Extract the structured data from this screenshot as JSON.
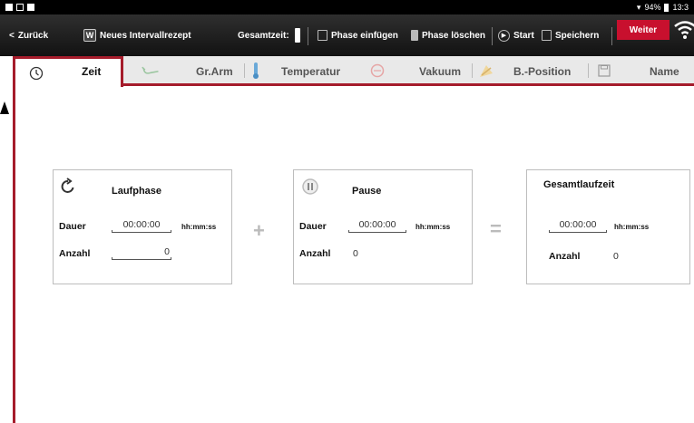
{
  "status_bar": {
    "battery": "94%",
    "time": "13:3"
  },
  "toolbar": {
    "back_label": "Zurück",
    "recipe_label": "Neues Intervallrezept",
    "total_time_label": "Gesamtzeit:",
    "insert_phase_label": "Phase einfügen",
    "delete_phase_label": "Phase löschen",
    "start_label": "Start",
    "save_label": "Speichern",
    "next_label": "Weiter"
  },
  "tabs": [
    {
      "label": "Zeit",
      "icon": "clock-icon",
      "active": true
    },
    {
      "label": "Gr.Arm",
      "icon": "arm-icon"
    },
    {
      "label": "Temperatur",
      "icon": "thermometer-icon"
    },
    {
      "label": "Vakuum",
      "icon": "vacuum-icon"
    },
    {
      "label": "B.-Position",
      "icon": "position-icon"
    },
    {
      "label": "Name",
      "icon": "save-icon"
    }
  ],
  "laufphase": {
    "title": "Laufphase",
    "dauer_label": "Dauer",
    "dauer_value": "00:00:00",
    "unit": "hh:mm:ss",
    "anzahl_label": "Anzahl",
    "anzahl_value": "0"
  },
  "pause": {
    "title": "Pause",
    "dauer_label": "Dauer",
    "dauer_value": "00:00:00",
    "unit": "hh:mm:ss",
    "anzahl_label": "Anzahl",
    "anzahl_value": "0"
  },
  "gesamt": {
    "title": "Gesamtlaufzeit",
    "dauer_value": "00:00:00",
    "unit": "hh:mm:ss",
    "anzahl_label": "Anzahl",
    "anzahl_value": "0"
  },
  "operators": {
    "plus": "+",
    "equals": "="
  },
  "colors": {
    "accent": "#a51c2b",
    "next_button": "#c8102e",
    "toolbar": "#1e1e1e"
  }
}
